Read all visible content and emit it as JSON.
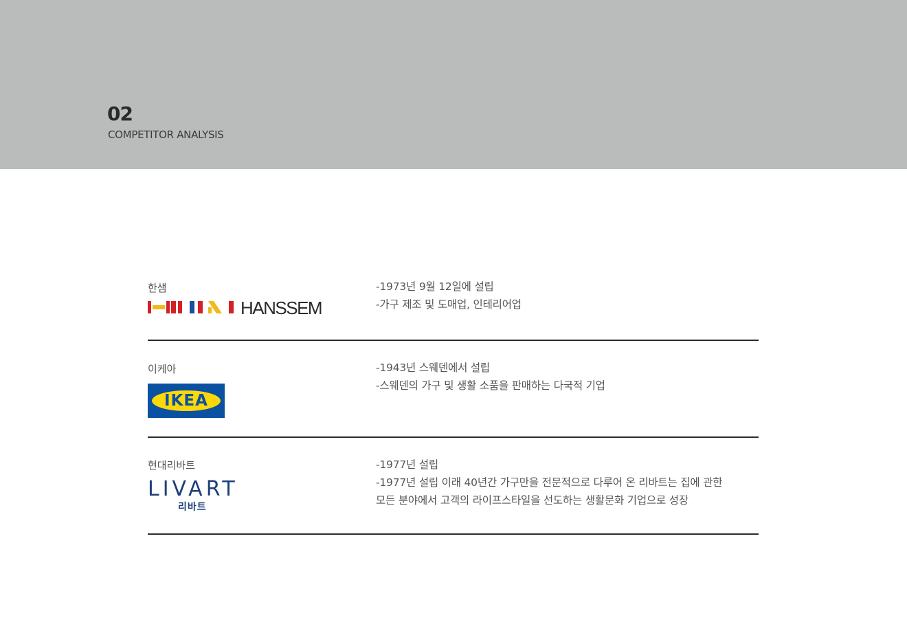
{
  "header": {
    "section_number": "02",
    "section_title": "COMPETITOR ANALYSIS",
    "background_color": "#babcbb"
  },
  "competitors": [
    {
      "name": "한샘",
      "logo_text": "HANSSEM",
      "logo_icon": "hanssem-flag-bars-icon",
      "description": [
        "-1973년 9월 12일에 설립",
        "-가구 제조 및 도매업, 인테리어업"
      ]
    },
    {
      "name": "이케아",
      "logo_text": "IKEA",
      "logo_colors": {
        "background": "#0a51a1",
        "oval": "#fcd80a"
      },
      "description": [
        "-1943년 스웨덴에서 설립",
        "-스웨덴의 가구 및 생활 소품을 판매하는 다국적 기업"
      ]
    },
    {
      "name": "현대리바트",
      "logo_text": "LIVART",
      "logo_subtext": "리바트",
      "logo_color": "#1f3f7a",
      "description": [
        "-1977년 설립",
        "-1977년 설립 이래 40년간 가구만을 전문적으로 다루어 온 리바트는 집에 관한",
        "모든 분야에서 고객의 라이프스타일을 선도하는 생활문화 기업으로 성장"
      ]
    }
  ]
}
